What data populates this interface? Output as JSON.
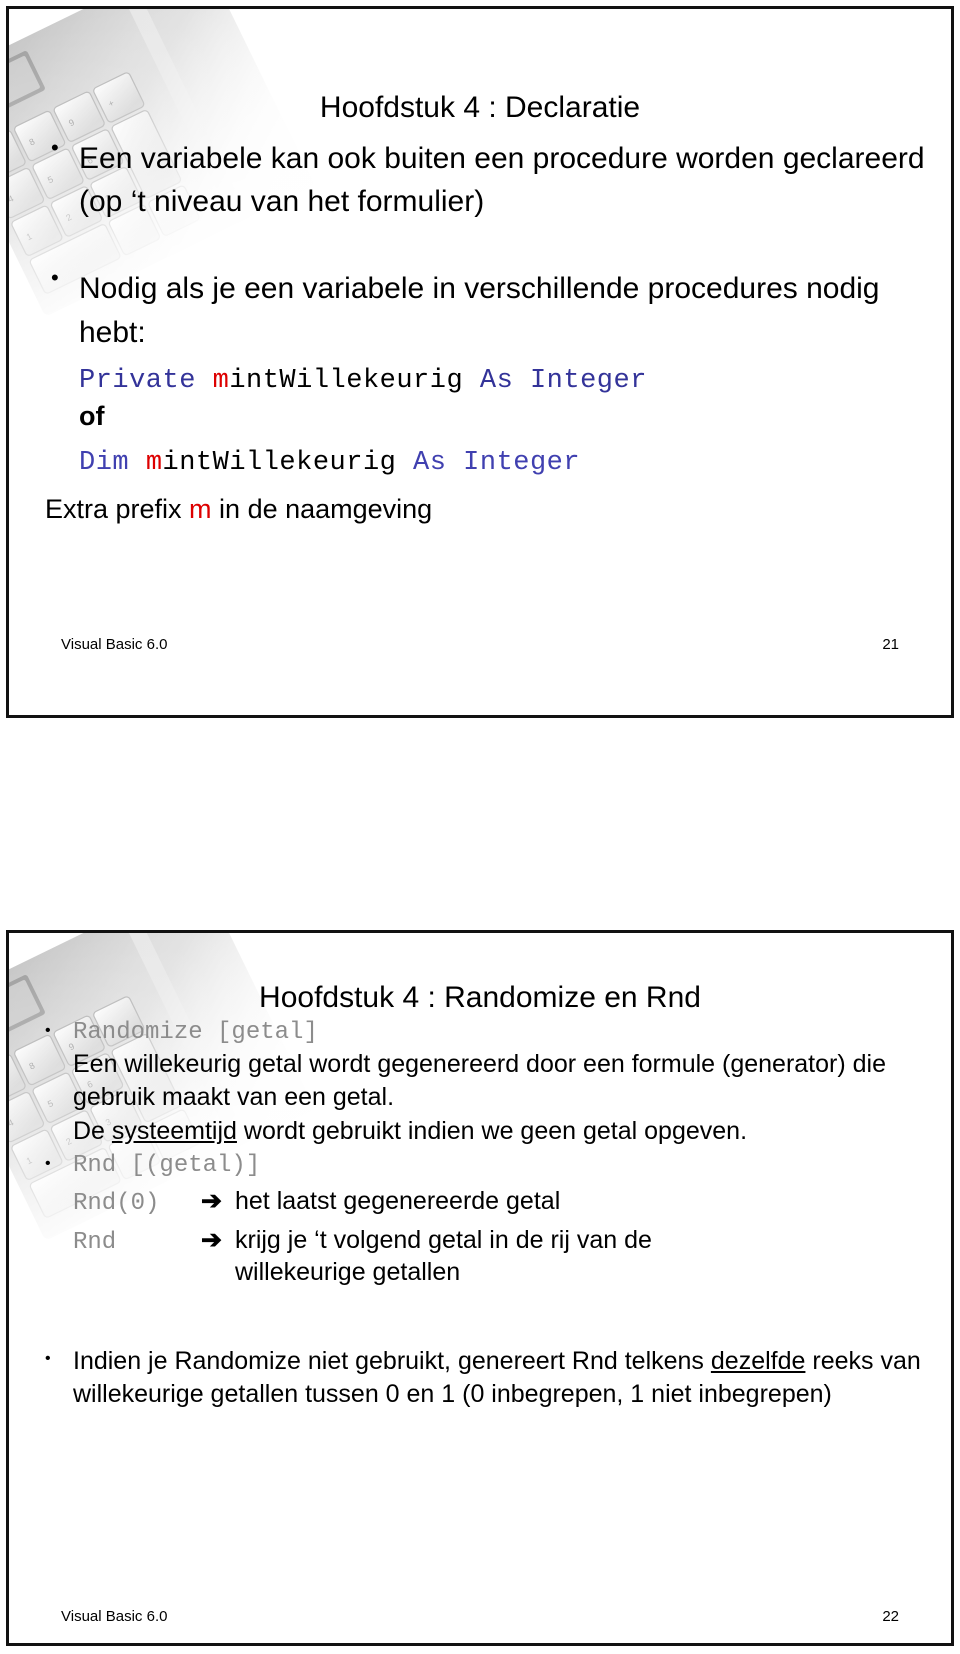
{
  "document": {
    "kind": "presentation-handout",
    "slide_count": 2
  },
  "slides": [
    {
      "title": "Hoofdstuk 4 : Declaratie",
      "bullets": {
        "b1": "Een variabele kan ook buiten een procedure worden geclareerd (op ‘t niveau van het formulier)",
        "b2": "Nodig als je een variabele in verschillende procedures nodig hebt:"
      },
      "code": {
        "line1_kw1": "Private ",
        "line1_prefix": "m",
        "line1_name": "intWillekeurig",
        "line1_kw2": " As Integer",
        "of": "of",
        "line2_kw1": "Dim ",
        "line2_prefix": "m",
        "line2_name": "intWillekeurig",
        "line2_kw2": " As Integer"
      },
      "note": {
        "pre": "Extra prefix ",
        "prefix": "m",
        "post": " in de naamgeving"
      },
      "footer": {
        "label": "Visual Basic 6.0",
        "page": "21"
      }
    },
    {
      "title": "Hoofdstuk 4 : Randomize en Rnd",
      "b1": {
        "code": "Randomize [getal]",
        "text_line1": "Een willekeurig getal wordt gegenereerd door een formule (generator) die gebruik maakt van een getal.",
        "text_line2_pre": "De ",
        "text_line2_underline": "systeemtijd",
        "text_line2_post": " wordt gebruikt indien we geen getal opgeven."
      },
      "b2": {
        "code": "Rnd [(getal)]",
        "row1_code": "Rnd(0)",
        "row1_arrow": "➔",
        "row1_text": "het laatst gegenereerde getal",
        "row2_code": "Rnd",
        "row2_arrow": "➔",
        "row2_text": "krijg je ‘t volgend getal in de rij van de",
        "row2_text_cont": "willekeurige getallen"
      },
      "b3": {
        "pre": "Indien je Randomize niet gebruikt, genereert Rnd telkens ",
        "underline": "dezelfde",
        "post": " reeks van willekeurige getallen tussen 0 en 1 (0 inbegrepen, 1 niet inbegrepen)"
      },
      "footer": {
        "label": "Visual Basic 6.0",
        "page": "22"
      }
    }
  ],
  "symbols": {
    "bullet": "•"
  },
  "colors": {
    "keyword_blue": "#333399",
    "keyword_blue_alt": "#4040b0",
    "prefix_red": "#dd0000",
    "code_gray": "#8c8c8c",
    "text_black": "#000000",
    "slide_border": "#111111"
  }
}
